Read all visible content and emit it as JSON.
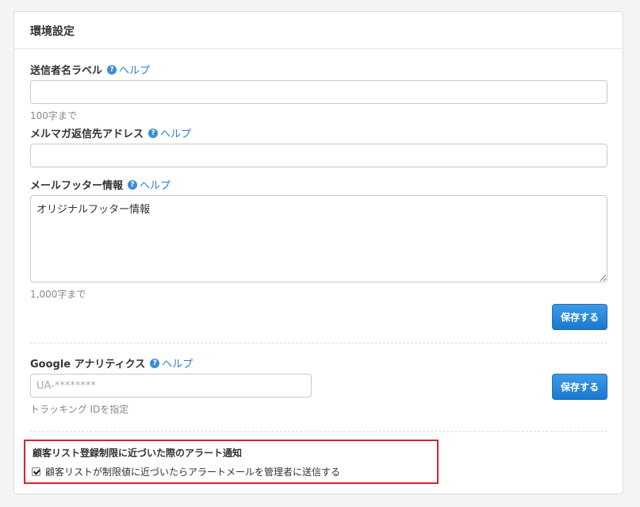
{
  "panel": {
    "title": "環境設定"
  },
  "sender_label": {
    "label": "送信者名ラベル",
    "help": "ヘルプ",
    "value": "",
    "hint": "100字まで"
  },
  "reply_address": {
    "label": "メルマガ返信先アドレス",
    "help": "ヘルプ",
    "value": ""
  },
  "footer": {
    "label": "メールフッター情報",
    "help": "ヘルプ",
    "value": "オリジナルフッター情報",
    "hint": "1,000字まで",
    "save_label": "保存する"
  },
  "analytics": {
    "label": "Google アナリティクス",
    "help": "ヘルプ",
    "placeholder": "UA-********",
    "hint": "トラッキング IDを指定",
    "save_label": "保存する"
  },
  "alert": {
    "title": "顧客リスト登録制限に近づいた際のアラート通知",
    "checkbox_label": "顧客リストが制限値に近づいたらアラートメールを管理者に送信する",
    "checked": true
  },
  "icons": {
    "help": "question-circle-icon"
  },
  "colors": {
    "link": "#2a7fd1",
    "button": "#1a78cf",
    "alert_border": "#d9232e"
  }
}
